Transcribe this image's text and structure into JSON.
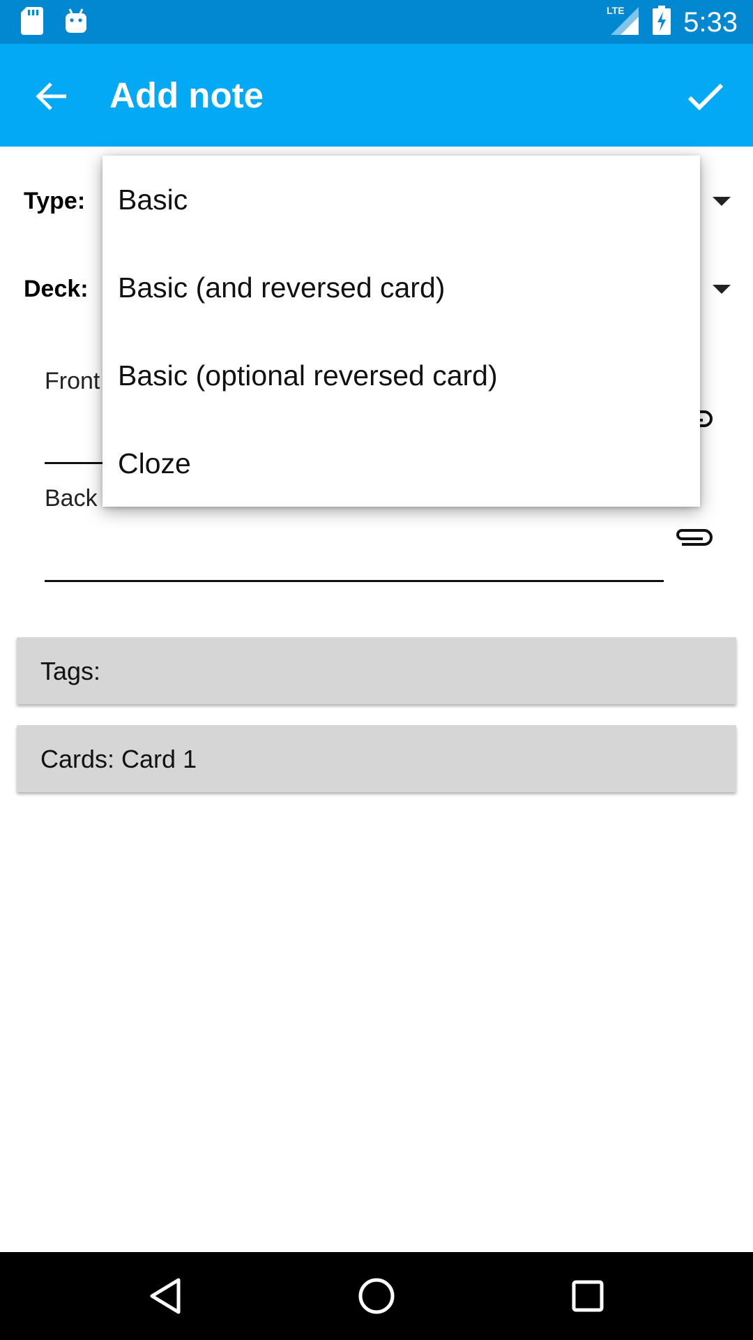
{
  "status_bar": {
    "time": "5:33",
    "network": "LTE",
    "icons": [
      "sd-card-icon",
      "android-icon",
      "lte-signal-icon",
      "battery-charging-icon"
    ]
  },
  "app_bar": {
    "title": "Add note",
    "back_icon": "arrow-back-icon",
    "confirm_icon": "check-icon",
    "background": "#03a9f4",
    "status_background": "#0288d1"
  },
  "form": {
    "type_label": "Type:",
    "deck_label": "Deck:",
    "fields": [
      {
        "label": "Front"
      },
      {
        "label": "Back"
      }
    ],
    "tags_label": "Tags:",
    "cards_label": "Cards: Card 1"
  },
  "type_menu": {
    "options": [
      "Basic",
      "Basic (and reversed card)",
      "Basic (optional reversed card)",
      "Cloze"
    ]
  },
  "nav_bar": {
    "icons": [
      "back-triangle-icon",
      "home-circle-icon",
      "recents-square-icon"
    ]
  }
}
